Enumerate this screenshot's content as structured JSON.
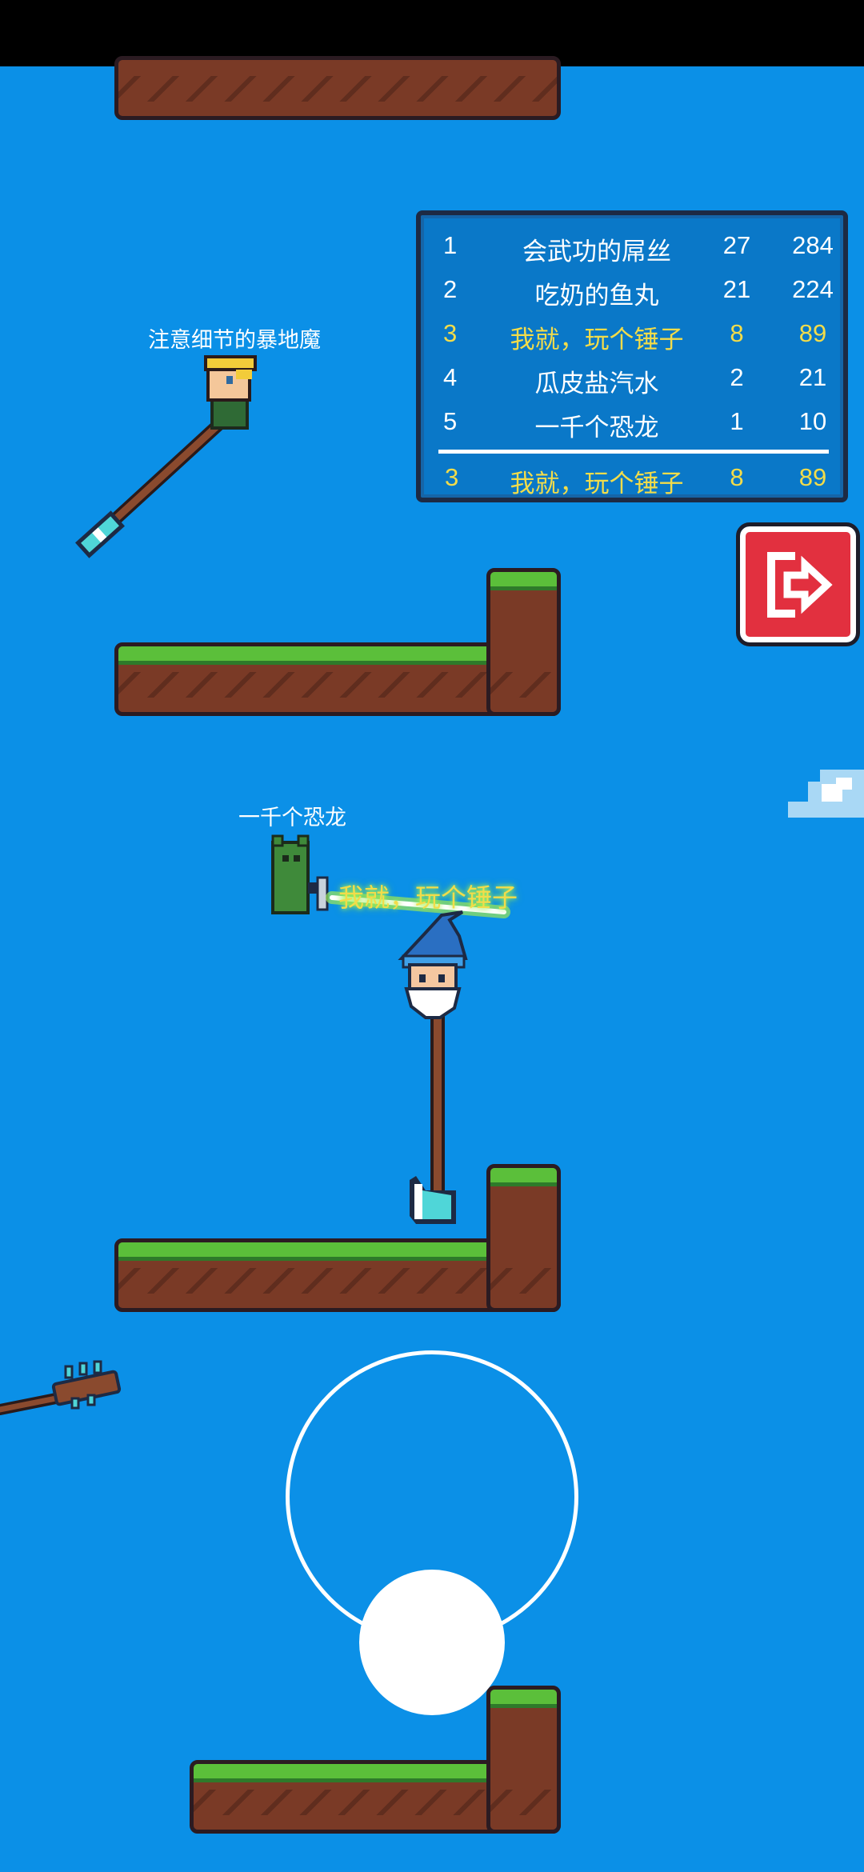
{
  "leaderboard": {
    "rows": [
      {
        "rank": "1",
        "name": "会武功的屌丝",
        "kills": "27",
        "score": "284"
      },
      {
        "rank": "2",
        "name": "吃奶的鱼丸",
        "kills": "21",
        "score": "224"
      },
      {
        "rank": "3",
        "name": "我就，玩个锤子",
        "kills": "8",
        "score": "89"
      },
      {
        "rank": "4",
        "name": "瓜皮盐汽水",
        "kills": "2",
        "score": "21"
      },
      {
        "rank": "5",
        "name": "一千个恐龙",
        "kills": "1",
        "score": "10"
      }
    ],
    "self": {
      "rank": "3",
      "name": "我就，玩个锤子",
      "kills": "8",
      "score": "89"
    }
  },
  "players": {
    "player1": "注意细节的暴地魔",
    "player2": "一千个恐龙",
    "self": "我就，玩个锤子"
  },
  "exit_button": {
    "icon": "exit-icon"
  },
  "colors": {
    "sky": "#0b90e7",
    "highlight": "#f2dc4a",
    "exit": "#e2303f"
  }
}
